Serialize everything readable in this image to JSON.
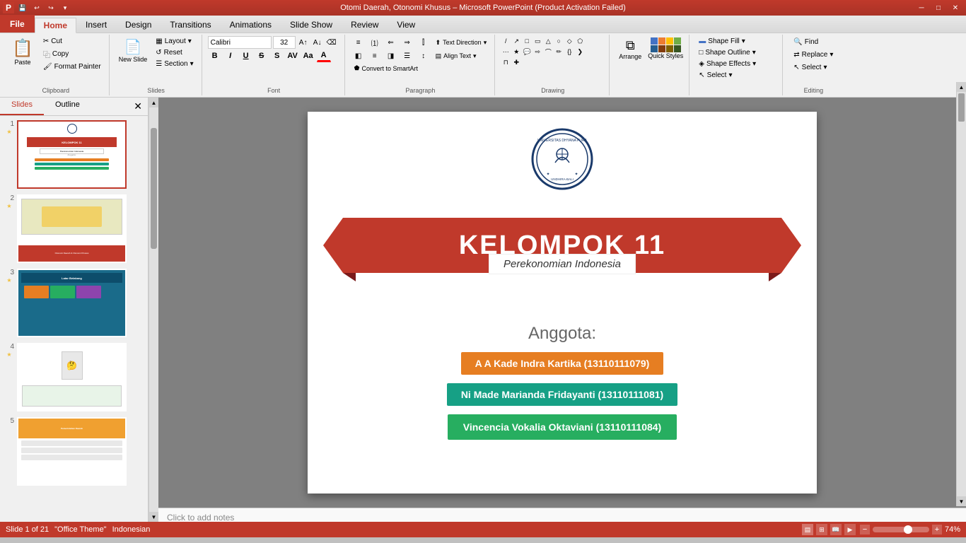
{
  "titleBar": {
    "title": "Otomi Daerah, Otonomi Khusus – Microsoft PowerPoint (Product Activation Failed)",
    "controls": [
      "–",
      "□",
      "✕"
    ]
  },
  "ribbon": {
    "tabs": [
      "File",
      "Home",
      "Insert",
      "Design",
      "Transitions",
      "Animations",
      "Slide Show",
      "Review",
      "View"
    ],
    "activeTab": "Home",
    "groups": {
      "clipboard": {
        "label": "Clipboard",
        "paste": "Paste",
        "cut": "Cut",
        "copy": "Copy",
        "formatPainter": "Format Painter"
      },
      "slides": {
        "label": "Slides",
        "newSlide": "New Slide",
        "layout": "Layout",
        "reset": "Reset",
        "section": "Section"
      },
      "font": {
        "label": "Font",
        "fontName": "Calibri",
        "fontSize": "32",
        "bold": "B",
        "italic": "I",
        "underline": "U",
        "strikethrough": "S",
        "shadow": "S",
        "charSpacing": "A",
        "caseBtn": "Aa",
        "fontColor": "A"
      },
      "paragraph": {
        "label": "Paragraph",
        "bullets": "≡",
        "numbering": "≡",
        "decIndent": "←",
        "incIndent": "→",
        "columns": "⫿",
        "textDirection": "Text Direction",
        "alignText": "Align Text",
        "convertSmartArt": "Convert to SmartArt",
        "alignLeft": "◧",
        "alignCenter": "◨",
        "alignRight": "◩",
        "justify": "▦",
        "lineSpacing": "≡"
      },
      "drawing": {
        "label": "Drawing",
        "shapes": [
          "□",
          "◻",
          "△",
          "○",
          "◇",
          "⬡",
          "➘",
          "⟶",
          "↩",
          "★",
          "{}",
          "♦",
          "╱",
          "⌒",
          "⌣",
          "∿",
          "≋",
          "❰",
          "❱",
          "⊂",
          "⊃",
          "⊆",
          "⊇",
          "∞"
        ]
      },
      "arrange": {
        "label": "Arrange",
        "arrange": "Arrange",
        "quickStyles": "Quick Styles"
      },
      "shapeEffects": {
        "label": "",
        "shapeFill": "Shape Fill",
        "shapeOutline": "Shape Outline",
        "shapeEffects": "Shape Effects",
        "select": "Select"
      },
      "editing": {
        "label": "Editing",
        "find": "Find",
        "replace": "Replace",
        "select": "Select"
      }
    }
  },
  "slidesPanel": {
    "tabs": [
      "Slides",
      "Outline"
    ],
    "slides": [
      {
        "num": 1,
        "active": true,
        "label": "Title slide"
      },
      {
        "num": 2,
        "label": "Otonomi Daerah slide"
      },
      {
        "num": 3,
        "label": "Latar Belakang slide"
      },
      {
        "num": 4,
        "label": "Question slide"
      },
      {
        "num": 5,
        "label": "Pemerintahan Daerah"
      }
    ]
  },
  "mainSlide": {
    "universityName": "UNIVERSITAS DHYANA PURA",
    "groupTitle": "KELOMPOK 11",
    "subject": "Perekonomian Indonesia",
    "membersLabel": "Anggota:",
    "members": [
      {
        "name": "A A Kade Indra Kartika (13110111079)",
        "color": "orange"
      },
      {
        "name": "Ni Made Marianda Fridayanti (13110111081)",
        "color": "teal"
      },
      {
        "name": "Vincencia Vokalia Oktaviani (13110111084)",
        "color": "green"
      }
    ]
  },
  "notes": {
    "placeholder": "Click to add notes"
  },
  "statusBar": {
    "slideInfo": "Slide 1 of 21",
    "theme": "\"Office Theme\"",
    "language": "Indonesian",
    "zoom": "74%"
  }
}
